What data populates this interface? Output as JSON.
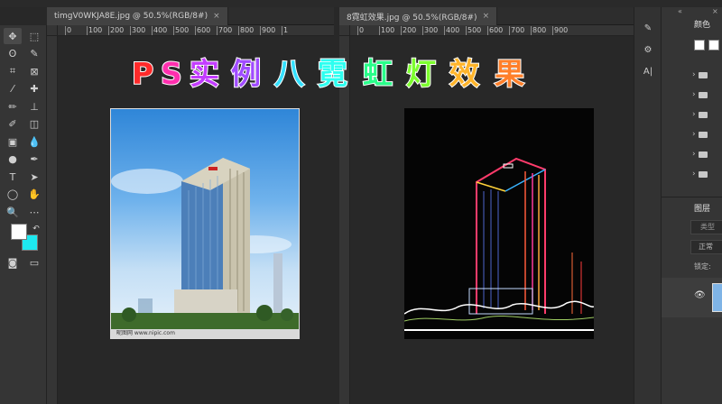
{
  "documents": [
    {
      "tab_label": "timgV0WKJA8E.jpg @ 50.5%(RGB/8#)",
      "close": "×",
      "ruler_ticks": [
        "0",
        "100",
        "200",
        "300",
        "400",
        "500",
        "600",
        "700",
        "800",
        "900",
        "1"
      ],
      "image": "original-building-photo"
    },
    {
      "tab_label": "8霓虹效果.jpg @ 50.5%(RGB/8#)",
      "close": "×",
      "ruler_ticks": [
        "0",
        "100",
        "200",
        "300",
        "400",
        "500",
        "600",
        "700",
        "800",
        "900"
      ],
      "image": "neon-effect-building-photo"
    }
  ],
  "overlay_title": {
    "chars": [
      "P",
      "S",
      "实",
      "例",
      "八",
      "霓",
      "虹",
      "灯",
      "效",
      "果"
    ],
    "colors": [
      "#ff2a2a",
      "#ff2fae",
      "#c33cff",
      "#a04bff",
      "#33e0ff",
      "#2dfff0",
      "#29ff8a",
      "#7dff2e",
      "#ffb42a",
      "#ff7f2a"
    ]
  },
  "photo1_caption": "昵图网 www.nipic.com",
  "tools": [
    {
      "icon": "move-icon",
      "glyph": "✥"
    },
    {
      "icon": "marquee-icon",
      "glyph": "⬚"
    },
    {
      "icon": "lasso-icon",
      "glyph": "ʘ"
    },
    {
      "icon": "quick-select-icon",
      "glyph": "✎"
    },
    {
      "icon": "crop-icon",
      "glyph": "⌗"
    },
    {
      "icon": "frame-icon",
      "glyph": "⊠"
    },
    {
      "icon": "eyedropper-icon",
      "glyph": "⁄"
    },
    {
      "icon": "healing-icon",
      "glyph": "✚"
    },
    {
      "icon": "brush-icon",
      "glyph": "✏"
    },
    {
      "icon": "stamp-icon",
      "glyph": "⊥"
    },
    {
      "icon": "history-brush-icon",
      "glyph": "✐"
    },
    {
      "icon": "eraser-icon",
      "glyph": "◫"
    },
    {
      "icon": "gradient-icon",
      "glyph": "▣"
    },
    {
      "icon": "blur-icon",
      "glyph": "💧"
    },
    {
      "icon": "dodge-icon",
      "glyph": "●"
    },
    {
      "icon": "pen-icon",
      "glyph": "✒"
    },
    {
      "icon": "type-icon",
      "glyph": "T"
    },
    {
      "icon": "path-select-icon",
      "glyph": "➤"
    },
    {
      "icon": "ellipse-icon",
      "glyph": "◯"
    },
    {
      "icon": "hand-icon",
      "glyph": "✋"
    },
    {
      "icon": "zoom-icon",
      "glyph": "🔍"
    },
    {
      "icon": "more-icon",
      "glyph": "⋯"
    }
  ],
  "swap_icon": "↶",
  "quickmask_icon": "◙",
  "screenmode_icon": "▭",
  "right_panel": {
    "color_tab": "颜色",
    "layers_tab": "图层",
    "search_placeholder": "类型",
    "blend_mode": "正常",
    "lock_label": "锁定:",
    "collapse_icon": "«",
    "close_icon": "×"
  },
  "mini_panel": [
    {
      "icon": "brush-settings-icon",
      "glyph": "✎"
    },
    {
      "icon": "adjust-icon",
      "glyph": "⚙"
    },
    {
      "icon": "character-icon",
      "glyph": "A|"
    }
  ],
  "folder_rows": [
    "›",
    "›",
    "›",
    "›",
    "›",
    "›"
  ],
  "eye_icon": "👁"
}
